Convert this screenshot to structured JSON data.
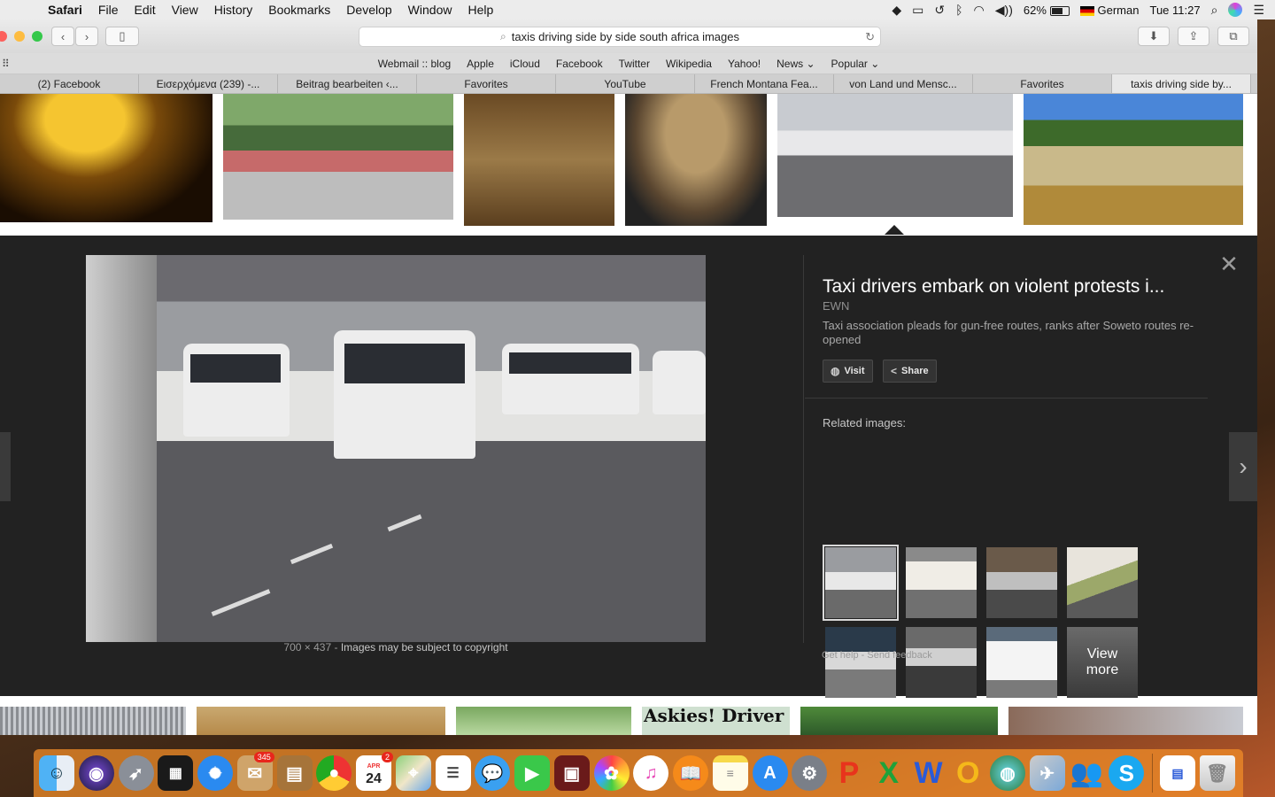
{
  "menubar": {
    "apple_icon": "apple-logo-icon",
    "app_name": "Safari",
    "menus": [
      "File",
      "Edit",
      "View",
      "History",
      "Bookmarks",
      "Develop",
      "Window",
      "Help"
    ],
    "battery_percent": "62%",
    "input_source": "German",
    "clock": "Tue 11:27"
  },
  "toolbar": {
    "address": "taxis driving side by side south africa images"
  },
  "favorites_bar": [
    "Webmail :: blog",
    "Apple",
    "iCloud",
    "Facebook",
    "Twitter",
    "Wikipedia",
    "Yahoo!",
    "News ⌄",
    "Popular ⌄"
  ],
  "tabs": [
    {
      "label": "(2) Facebook",
      "active": false
    },
    {
      "label": "Εισερχόμενα (239) -...",
      "active": false
    },
    {
      "label": "Beitrag bearbeiten ‹...",
      "active": false
    },
    {
      "label": "Favorites",
      "active": false
    },
    {
      "label": "YouTube",
      "active": false
    },
    {
      "label": "French Montana Fea...",
      "active": false
    },
    {
      "label": "von Land und Mensc...",
      "active": false
    },
    {
      "label": "Favorites",
      "active": false
    },
    {
      "label": "taxis driving side by...",
      "active": true
    }
  ],
  "new_tab_label": "+",
  "preview": {
    "title": "Taxi drivers embark on violent protests i...",
    "source": "EWN",
    "description": "Taxi association pleads for gun-free routes, ranks after Soweto routes re-opened",
    "visit_label": "Visit",
    "share_label": "Share",
    "related_label": "Related images:",
    "view_more_label": "View more",
    "dimensions": "700 × 437",
    "separator": "-",
    "copyright": "Images may be subject to copyright",
    "get_help": "Get help",
    "send_feedback": "Send feedback",
    "link_separator": "-"
  },
  "bottom_strip_text": "Askies! Driver",
  "dock": {
    "mail_badge": "345",
    "calendar_month": "APR",
    "calendar_day": "24",
    "calendar_badge": "2"
  }
}
